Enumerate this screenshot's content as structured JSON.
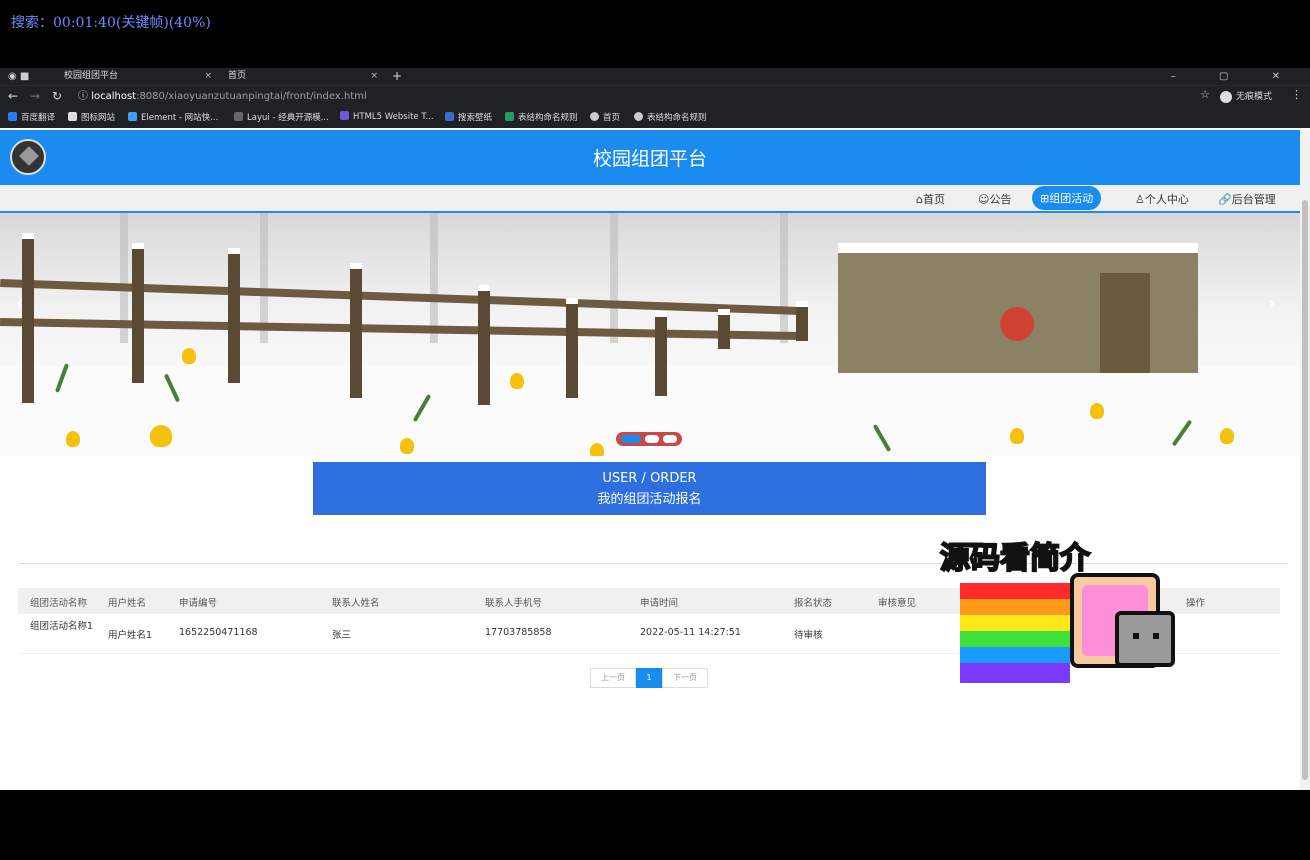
{
  "overlay": {
    "search_text": "搜索：00:01:40(关键帧)(40%)"
  },
  "browser": {
    "tabs": [
      {
        "label": "校园组团平台",
        "close": "×"
      },
      {
        "label": "首页",
        "close": "×"
      }
    ],
    "new_tab": "+",
    "url_host": "localhost",
    "url_path": ":8080/xiaoyuanzutuanpingtai/front/index.html",
    "incognito_label": "无痕模式",
    "bookmarks": [
      {
        "label": "百度翻译",
        "color": "#2a7cf0"
      },
      {
        "label": "图标网站",
        "color": "#dddddd"
      },
      {
        "label": "Element - 网站快...",
        "color": "#409eff"
      },
      {
        "label": "Layui - 经典开源模...",
        "color": "#666666"
      },
      {
        "label": "HTML5 Website T...",
        "color": "#6b5bd6"
      },
      {
        "label": "搜索壁纸",
        "color": "#3a6ccf"
      },
      {
        "label": "表结构命名规则",
        "color": "#1e9e6b"
      },
      {
        "label": "首页",
        "color": "#cccccc"
      },
      {
        "label": "表结构命名规则",
        "color": "#cccccc"
      }
    ]
  },
  "site": {
    "title": "校园组团平台",
    "nav": [
      {
        "label": "⌂首页",
        "active": false
      },
      {
        "label": "☺公告",
        "active": false
      },
      {
        "label": "⊞组团活动",
        "active": true
      },
      {
        "label": "♙个人中心",
        "active": false
      },
      {
        "label": "🔗后台管理",
        "active": false
      }
    ],
    "accent": "#1a8cf0"
  },
  "section": {
    "title_en": "USER / ORDER",
    "title_cn": "我的组团活动报名"
  },
  "table": {
    "headers": [
      "组团活动名称",
      "用户姓名",
      "申请编号",
      "联系人姓名",
      "联系人手机号",
      "申请时间",
      "报名状态",
      "审核意见",
      "操作"
    ],
    "rows": [
      [
        "组团活动名称1",
        "用户姓名1",
        "1652250471168",
        "张三",
        "17703785858",
        "2022-05-11 14:27:51",
        "待审核",
        ""
      ]
    ]
  },
  "pagination": {
    "prev": "上一页",
    "current": "1",
    "next": "下一页"
  },
  "sticker": {
    "text": "源码看简介"
  }
}
